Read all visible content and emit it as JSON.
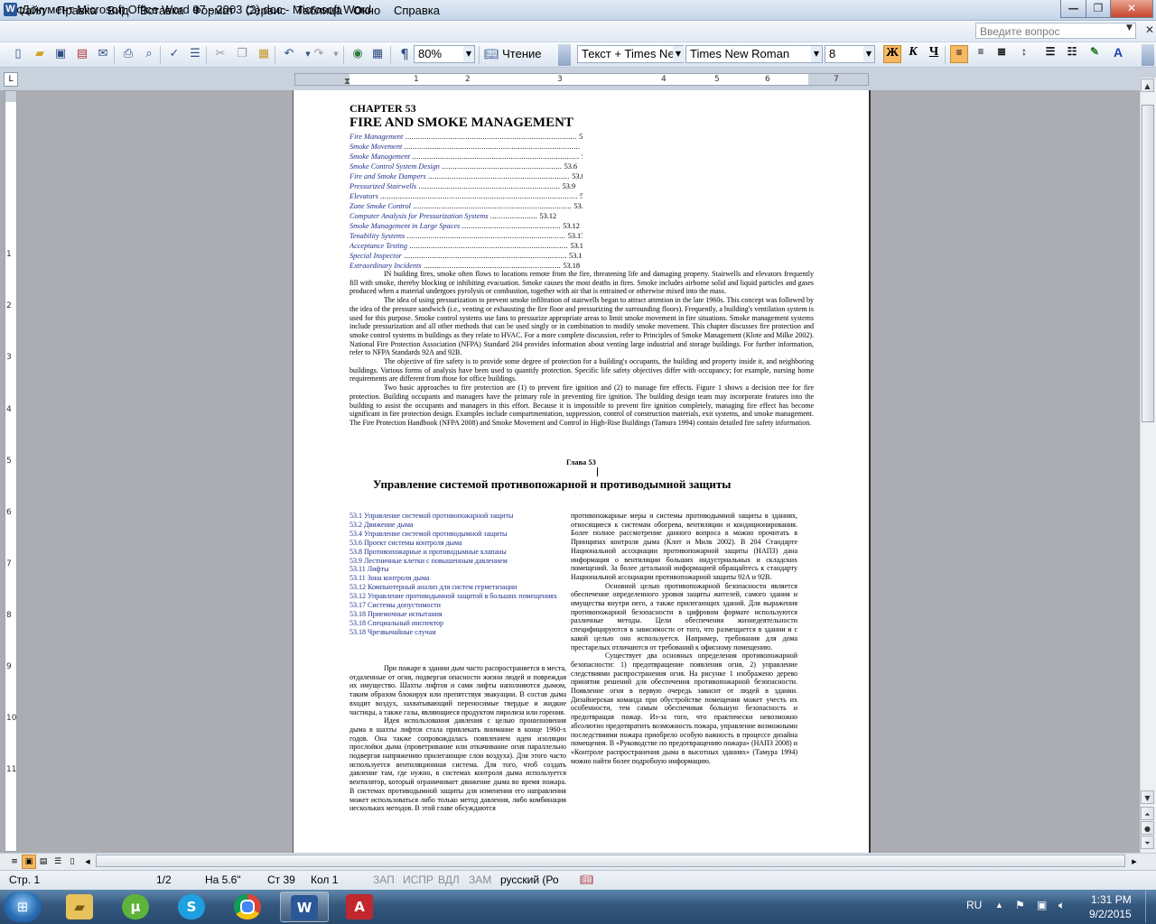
{
  "window": {
    "title": "Документ Microsoft Office Word 97 - 2003 (2).doc - Microsoft Word",
    "app_icon": "W"
  },
  "menu": [
    "Файл",
    "Правка",
    "Вид",
    "Вставка",
    "Формат",
    "Сервис",
    "Таблица",
    "Окно",
    "Справка"
  ],
  "help_box": {
    "placeholder": "Введите вопрос"
  },
  "toolbar": {
    "zoom": "80%",
    "reading_label": "Чтение",
    "style": "Текст + Times New",
    "font": "Times New Roman",
    "size": "8",
    "bold_label": "Ж",
    "italic_label": "К",
    "underline_label": "Ч"
  },
  "ruler": {
    "numbers": [
      "1",
      "2",
      "3",
      "4",
      "5",
      "6",
      "7"
    ],
    "vnumbers": [
      "1",
      "2",
      "3",
      "4",
      "5",
      "6",
      "7",
      "8",
      "9",
      "10",
      "11"
    ]
  },
  "document": {
    "chapter": "CHAPTER 53",
    "heading": "FIRE AND SMOKE MANAGEMENT",
    "toc": [
      {
        "label": "Fire Management",
        "page": "53.1"
      },
      {
        "label": "Smoke Movement",
        "page": "53.2"
      },
      {
        "label": "Smoke Management",
        "page": "53.4"
      },
      {
        "label": "Smoke Control System Design",
        "page": "53.6"
      },
      {
        "label": "Fire and Smoke Dampers",
        "page": "53.8"
      },
      {
        "label": "Pressurized Stairwells",
        "page": "53.9"
      },
      {
        "label": "Elevators",
        "page": "53.11"
      },
      {
        "label": "Zone Smoke Control",
        "page": "53.11"
      },
      {
        "label": "Computer Analysis for Pressurization Systems",
        "page": "53.12"
      },
      {
        "label": "Smoke Management in Large Spaces",
        "page": "53.12"
      },
      {
        "label": "Tenability Systems",
        "page": "53.17"
      },
      {
        "label": "Acceptance Testing",
        "page": "53.18"
      },
      {
        "label": "Special Inspector",
        "page": "53.18"
      },
      {
        "label": "Extraordinary Incidents",
        "page": "53.18"
      }
    ],
    "en_paragraphs": [
      "IN building fires, smoke often flows to locations remote from the fire, threatening life and damaging property. Stairwells and elevators frequently fill with smoke, thereby blocking or inhibiting evacuation. Smoke causes the most deaths in fires. Smoke includes airborne solid and liquid particles and gases produced when a material undergoes pyrolysis or combustion, together with air that is entrained or otherwise mixed into the mass.",
      "The idea of using pressurization to prevent smoke infiltration of stairwells began to attract attention in the late 1960s. This concept was followed by the idea of the pressure sandwich (i.e., venting or exhausting the fire floor and pressurizing the surrounding floors). Frequently, a building's ventilation system is used for this purpose. Smoke control systems use fans to pressurize appropriate areas to limit smoke movement in fire situations. Smoke management systems include pressurization and all other methods that can be used singly or in combination to modify smoke movement. This chapter discusses fire protection and smoke control systems in buildings as they relate to HVAC. For a more complete discussion, refer to Principles of Smoke Management (Klote and Milke 2002). National Fire Protection Association (NFPA) Standard 204 provides information about venting large industrial and storage buildings. For further information, refer to NFPA Standards 92A and 92B.",
      "The objective of fire safety is to provide some degree of protection for a building's occupants, the building and property inside it, and neighboring buildings. Various forms of analysis have been used to quantify protection. Specific life safety objectives differ with occupancy; for example, nursing home requirements are different from those for office buildings.",
      "Two basic approaches to fire protection are (1) to prevent fire ignition and (2) to manage fire effects. Figure 1 shows a decision tree for fire protection. Building occupants and managers have the primary role in preventing fire ignition. The building design team may incorporate features into the building to assist the occupants and managers in this effort. Because it is impossible to prevent fire ignition completely, managing fire effect has become significant in fire protection design. Examples include compartmentation, suppression, control of construction materials, exit systems, and smoke management. The Fire Protection Handbook (NFPA 2008) and Smoke Movement and Control in High-Rise Buildings (Tamura 1994) contain detailed fire safety information."
    ],
    "ru_chapter": "Глава 53",
    "ru_heading": "Управление системой противопожарной и противодымной защиты",
    "ru_toc": [
      "53.1 Управление системой противопожарной защиты",
      "53.2 Движение дыма",
      "53.4 Управление системой противодымной защиты",
      "53.6 Проект системы контроля дыма",
      "53.8 Противопожарные и противодымные клапаны",
      "53.9 Лестничные клетки с повышенным давлением",
      "53.11 Лифты",
      "53.11 Зона контроля дыма",
      "53.12 Компьютерный анализ для систем герметизации",
      "53.12 Управление противодымной защитой в больших помещениях",
      "53.17 Системы допустимости",
      "53.18 Приемочные испытания",
      "53.18 Специальный инспектор",
      "53.18 Чрезвычайные случаи"
    ],
    "ru_left_paragraphs": [
      "При пожаре в здании дым часто распространяется в места, отдаленные от огня, подвергая опасности жизни людей и повреждая их имущество. Шахты лифтов и сами лифты наполняются дымом, таким образом блокируя или препятствуя эвакуации. В состав дыма входит воздух, захватывающий переносимые твердые и жидкие частицы, а также газы, являющиеся продуктом пиролиза или горения.",
      "Идея использования давления с целью пронизновения дыма в шахты лифтов стала привлекать внимание в конце 1960-х годов. Она также сопровождалась появлением идеи изоляции прослойки дыма (проветривание или откачивание огня параллельно подвергая напряжению прилегающие слои воздуха). Для этого часто используется вентиляционная система. Для того, чтоб создать давление там, где нужно, в системах контроля дыма используется вентилятор, который ограничивает движение дыма во время пожара. В системах противодымной защиты для изменения его направления может использоваться либо только метод давления, либо комбинация нескольких методов. В этой главе обсуждаются"
    ],
    "ru_right_paragraphs": [
      "противопожарные меры и системы противодымной защиты в зданиях, относящиеся к системам обогрева, вентиляции и кондиционирования. Более полное рассмотрение данного вопроса в можно прочитать в Принципах контроля дыма (Клот и Милк 2002). В 204 Стандарте Национальной ассоциации противопожарной защиты (НАПЗ) дана информация о вентиляции больших индустриальных и складских помещений. За более детальной информацией обращайтесь к стандарту Национальной ассоциации противопожарной защиты 92А и 92В.",
      "Основной целью противопожарной безопасности является обеспечение определенного уровня защиты жителей, самого здания и имущества внутри него, а также прилегающих зданий. Для выражения противопожарной безопасности в цифровом формате используются различные методы. Цели обеспечения жизнедеятельности специфицируются в зависимости от того, что размещается в здании и с какой целью оно используется. Например, требования для дома престарелых отличаются от требований к офисному помещению.",
      "Существует два основных определения противопожарной безопасности: 1) предотвращение появления огня, 2) управление следствиями распространения огня. На рисунке 1 изображено дерево принятия решений для обеспечения противопожарной безопасности. Появление огня в первую очередь зависит от людей в здании. Дизайнерская команда при обустройстве помещения может учесть их особенности, тем самым обеспечивая большую безопасность и предотвращая пожар. Из-за того, что практически невозможно абсолютно предотвратить возможность пожара, управление возможными последствиями пожара приобрело особую важность в процессе дизайна помещения. В «Руководстве по предотвращению пожара» (НАПЗ 2008) и «Контроле распространения дыма в высотных зданиях» (Тамура 1994) можно найти более подробную информацию."
    ]
  },
  "status": {
    "page": "Стр. 1",
    "pages": "1/2",
    "at": "На 5.6\"",
    "line": "Ст 39",
    "col": "Кол 1",
    "rec": "ЗАП",
    "trk": "ИСПР",
    "ext": "ВДЛ",
    "ovr": "ЗАМ",
    "lang": "русский (Ро"
  },
  "taskbar": {
    "lang": "RU",
    "time": "1:31 PM",
    "date": "9/2/2015",
    "apps": [
      "explorer",
      "utorrent",
      "skype",
      "chrome",
      "word",
      "acrobat"
    ]
  }
}
